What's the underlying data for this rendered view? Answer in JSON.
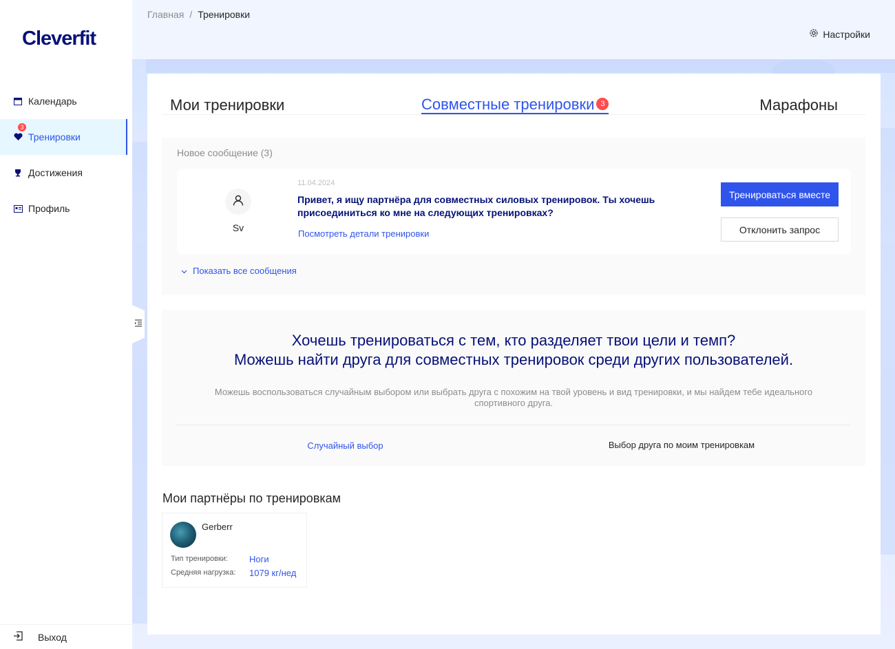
{
  "app": {
    "logo": "Cleverfit"
  },
  "sidebar": {
    "items": [
      {
        "label": "Календарь",
        "icon": "calendar-icon"
      },
      {
        "label": "Тренировки",
        "icon": "heart-icon",
        "badge": "3",
        "active": true
      },
      {
        "label": "Достижения",
        "icon": "trophy-icon"
      },
      {
        "label": "Профиль",
        "icon": "idcard-icon"
      }
    ],
    "logout": "Выход"
  },
  "header": {
    "breadcrumb": {
      "home": "Главная",
      "separator": "/",
      "current": "Тренировки"
    },
    "settings": "Настройки"
  },
  "tabs": {
    "my": "Мои тренировки",
    "joint": "Совместные тренировки",
    "joint_badge": "3",
    "marathons": "Марафоны"
  },
  "messages": {
    "title": "Новое сообщение (3)",
    "item": {
      "name": "Sv",
      "date": "11.04.2024",
      "text": "Привет, я ищу партнёра для совместных силовых тренировок. Ты хочешь присоединиться ко мне на следующих тренировках?",
      "link": "Посмотреть детали тренировки",
      "accept": "Тренироваться вместе",
      "decline": "Отклонить запрос"
    },
    "show_all": "Показать все сообщения"
  },
  "promo": {
    "title_line1": "Хочешь тренироваться с тем, кто разделяет твои цели и темп?",
    "title_line2": "Можешь найти друга для совместных тренировок среди других пользователей.",
    "description": "Можешь воспользоваться случайным выбором или выбрать друга с похожим на твой уровень и вид тренировки, и мы найдем тебе идеального спортивного друга.",
    "random": "Случайный выбор",
    "by_trainings": "Выбор друга по моим тренировкам"
  },
  "partners": {
    "title": "Мои партнёры по тренировкам",
    "items": [
      {
        "name": "Gerberr",
        "type_label": "Тип тренировки:",
        "type_value": "Ноги",
        "load_label": "Средняя нагрузка:",
        "load_value": "1079 кг/нед"
      }
    ]
  },
  "colors": {
    "primary": "#2f54eb",
    "title": "#061178",
    "badge": "#ff4d4f"
  }
}
